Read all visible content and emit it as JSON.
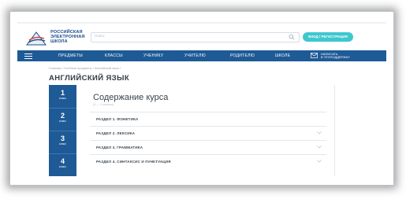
{
  "header": {
    "logo_text": [
      "РОССИЙСКАЯ",
      "ЭЛЕКТРОННАЯ",
      "ШКОЛА"
    ],
    "search_placeholder": "Поиск",
    "login_button": "ВХОД / РЕГИСТРАЦИЯ"
  },
  "nav": {
    "items": [
      "ПРЕДМЕТЫ",
      "КЛАССЫ",
      "УЧЕНИКУ",
      "УЧИТЕЛЮ",
      "РОДИТЕЛЮ",
      "ШКОЛЕ"
    ],
    "mail_text": [
      "НАПИСАТЬ",
      "В ТЕХПОДДЕРЖКУ"
    ]
  },
  "breadcrumb": "Главная / Учебные предметы / Английский язык /",
  "page_title": "АНГЛИЙСКИЙ ЯЗЫК",
  "grades": [
    {
      "num": "1",
      "label": "класс"
    },
    {
      "num": "2",
      "label": "класс"
    },
    {
      "num": "3",
      "label": "класс"
    },
    {
      "num": "4",
      "label": "класс"
    }
  ],
  "content": {
    "title": "Содержание курса",
    "subtitle": "(1 — 4 классы)",
    "sections": [
      "РАЗДЕЛ 1. ФОНЕТИКА",
      "РАЗДЕЛ 2. ЛЕКСИКА",
      "РАЗДЕЛ 3. ГРАММАТИКА",
      "РАЗДЕЛ 4. СИНТАКСИС И ПУНКТУАЦИЯ"
    ]
  },
  "colors": {
    "nav": "#1e5a96",
    "accent": "#3ec7cf"
  }
}
